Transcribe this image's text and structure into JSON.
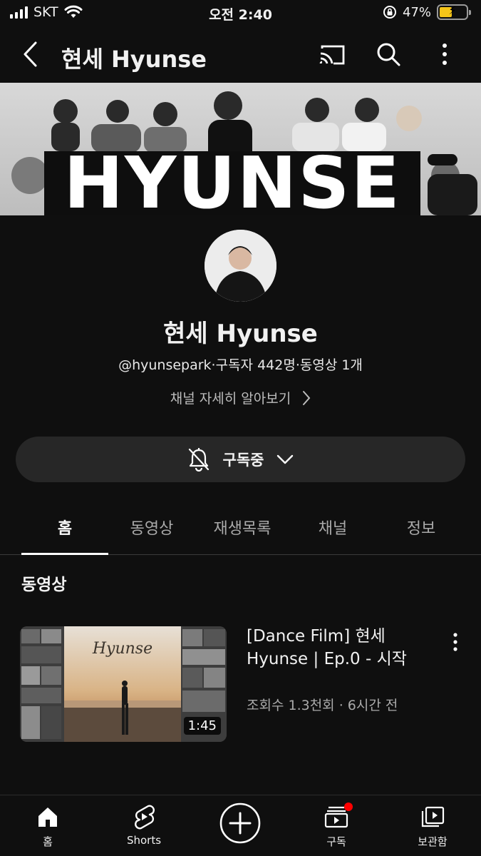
{
  "status_bar": {
    "carrier": "SKT",
    "time": "오전 2:40",
    "battery_percent": "47%",
    "battery_level": 0.47
  },
  "app_bar": {
    "title": "현세 Hyunse",
    "icons": [
      "back-icon",
      "cast-icon",
      "search-icon",
      "more-vertical-icon"
    ]
  },
  "banner": {
    "word": "HYUNSE"
  },
  "channel": {
    "name": "현세 Hyunse",
    "meta": "@hyunsepark·구독자 442명·동영상 1개",
    "about": "채널 자세히 알아보기"
  },
  "subscribe": {
    "label": "구독중"
  },
  "tabs": [
    {
      "label": "홈",
      "active": true
    },
    {
      "label": "동영상",
      "active": false
    },
    {
      "label": "재생목록",
      "active": false
    },
    {
      "label": "채널",
      "active": false
    },
    {
      "label": "정보",
      "active": false
    }
  ],
  "section": {
    "title": "동영상"
  },
  "video": {
    "thumb_text": "Hyunse",
    "duration": "1:45",
    "title": "[Dance Film] 현세 Hyunse | Ep.0 - 시작",
    "meta": "조회수 1.3천회 · 6시간 전"
  },
  "bottom_nav": [
    {
      "label": "홈",
      "icon": "home-icon"
    },
    {
      "label": "Shorts",
      "icon": "shorts-icon"
    },
    {
      "label": "",
      "icon": "create-icon"
    },
    {
      "label": "구독",
      "icon": "subscriptions-icon"
    },
    {
      "label": "보관함",
      "icon": "library-icon"
    }
  ],
  "colors": {
    "background": "#0f0f0f",
    "button": "#272727",
    "accent_red": "#ff0000",
    "battery": "#f5c518"
  }
}
